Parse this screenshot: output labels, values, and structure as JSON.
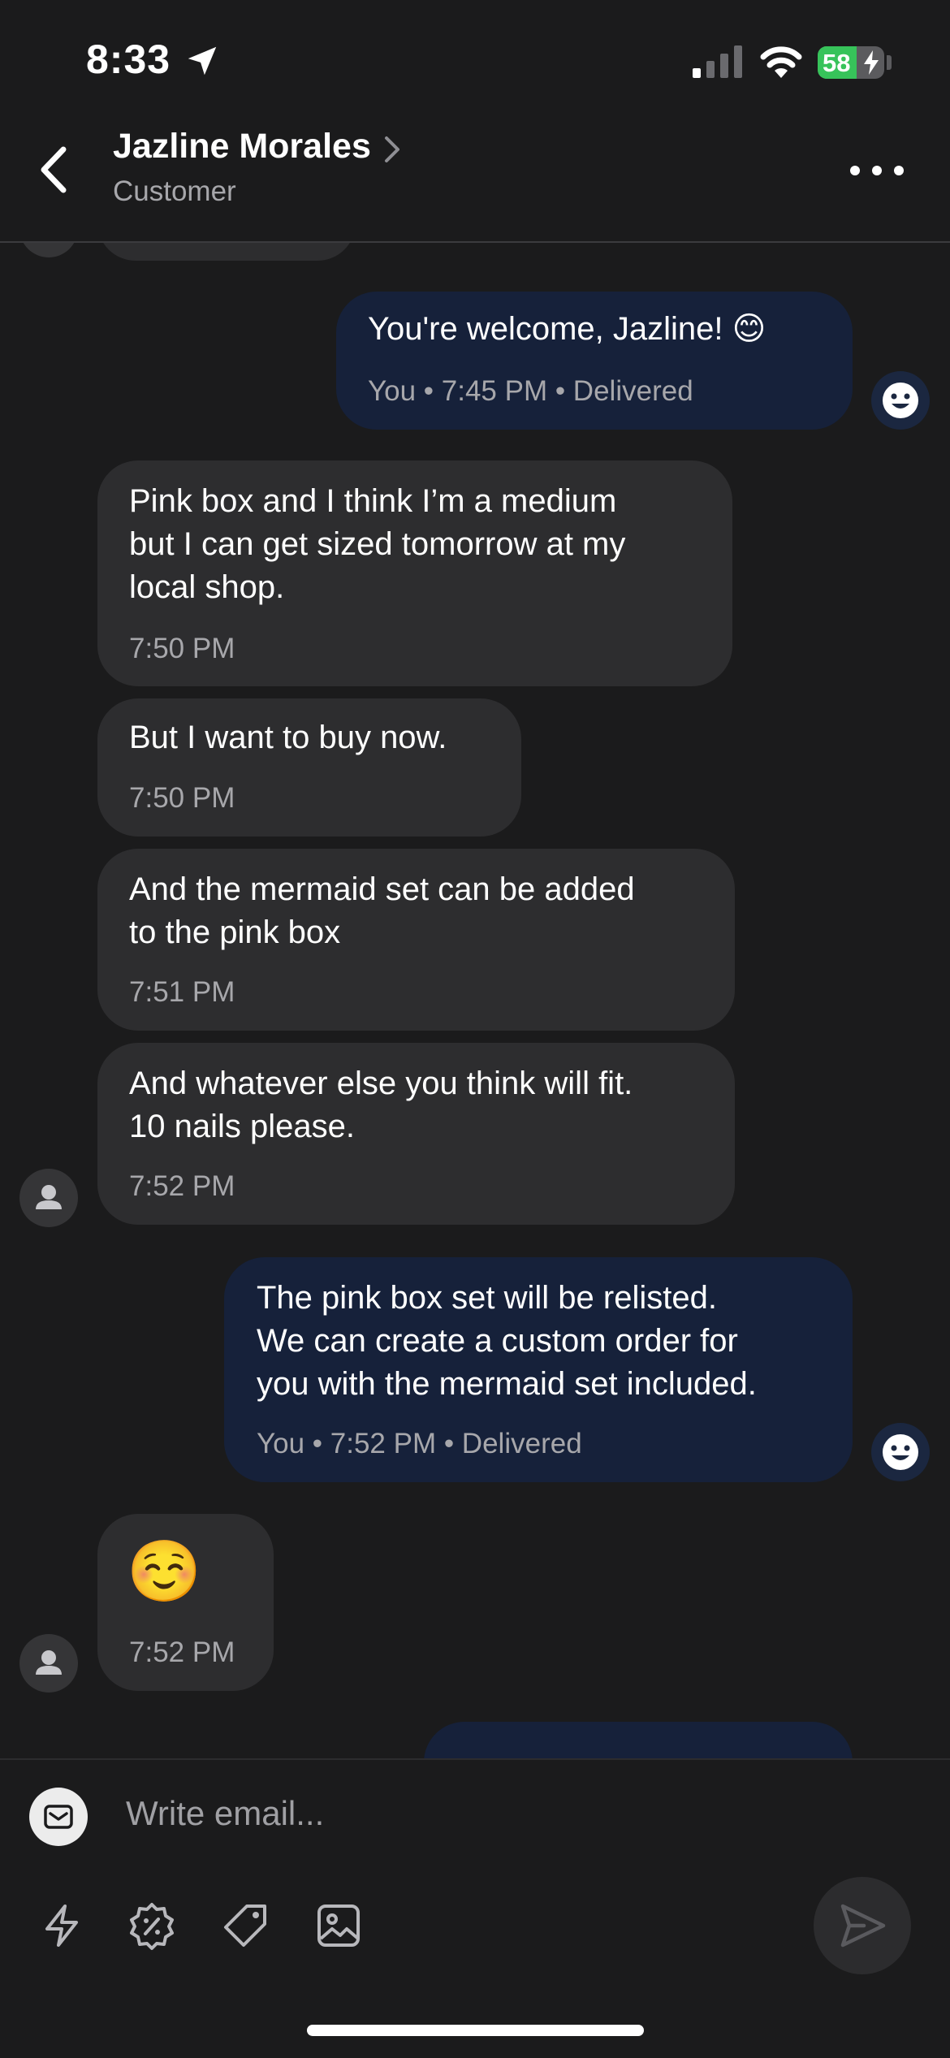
{
  "status_bar": {
    "time": "8:33",
    "battery_level": "58",
    "battery_fraction": 0.58
  },
  "header": {
    "contact_name": "Jazline Morales",
    "contact_role": "Customer"
  },
  "messages": [
    {
      "direction": "outgoing",
      "text": "You're welcome, Jazline! 😊",
      "meta": "You • 7:45 PM • Delivered"
    },
    {
      "direction": "incoming",
      "lines": [
        "Pink box and I think I’m a medium",
        "but I can get sized tomorrow at my",
        "local shop."
      ],
      "meta": "7:50 PM"
    },
    {
      "direction": "incoming",
      "text": "But I want to buy now.",
      "meta": "7:50 PM"
    },
    {
      "direction": "incoming",
      "lines": [
        "And the mermaid set can be added",
        "to the pink box"
      ],
      "meta": "7:51 PM"
    },
    {
      "direction": "incoming",
      "lines": [
        "And whatever else you think will fit.",
        "10 nails please."
      ],
      "meta": "7:52 PM"
    },
    {
      "direction": "outgoing",
      "lines": [
        "The pink box set will be relisted.",
        "We can create a custom order for",
        "you with the mermaid set included."
      ],
      "meta": "You • 7:52 PM • Delivered"
    },
    {
      "direction": "incoming",
      "text": "☺️",
      "meta": "7:52 PM"
    }
  ],
  "composer": {
    "placeholder": "Write email..."
  },
  "icons": {
    "back": "chevron-left-icon",
    "more": "ellipsis-icon",
    "email": "envelope-icon",
    "quick_reply": "lightning-icon",
    "discount": "percent-badge-icon",
    "tag": "tag-icon",
    "image": "image-icon",
    "send": "send-icon"
  },
  "colors": {
    "background": "#1b1b1c",
    "incoming_bubble": "#2d2d2f",
    "outgoing_bubble": "#16213a",
    "battery_green": "#37c35a"
  }
}
